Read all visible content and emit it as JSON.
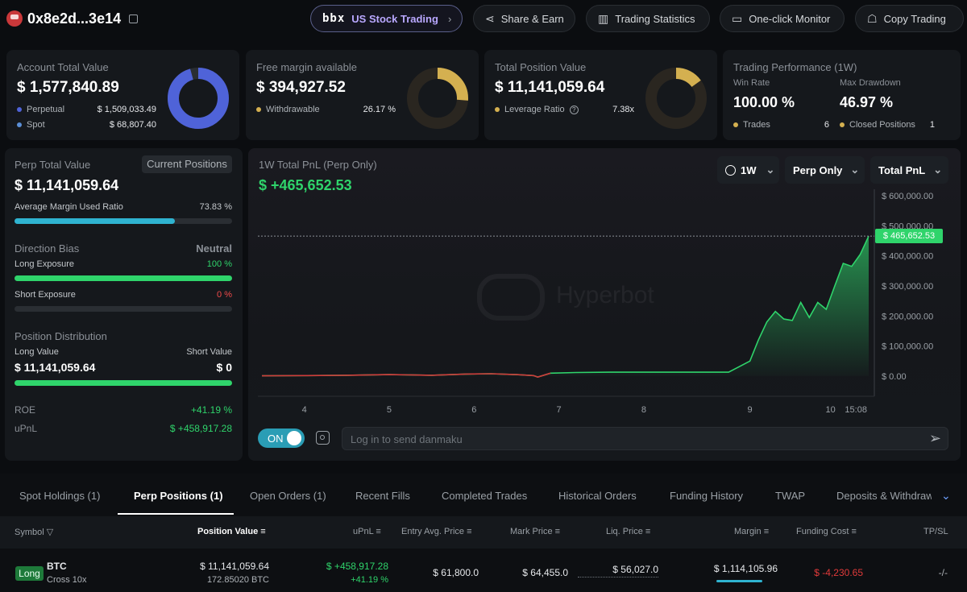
{
  "header": {
    "address": "0x8e2d...3e14",
    "buttons": {
      "us_stock_brand": "bbx",
      "us_stock": "US Stock Trading",
      "share": "Share & Earn",
      "stats": "Trading Statistics",
      "monitor": "One-click Monitor",
      "copy": "Copy Trading"
    }
  },
  "account": {
    "title": "Account Total Value",
    "value": "$ 1,577,840.89",
    "rows": [
      {
        "label": "Perpetual",
        "value": "$ 1,509,033.49",
        "color": "#4f63d8"
      },
      {
        "label": "Spot",
        "value": "$ 68,807.40",
        "color": "#5b8fd6"
      }
    ],
    "donut_fraction": 0.956,
    "donut_color": "#4f63d8"
  },
  "margin": {
    "title": "Free margin available",
    "value": "$ 394,927.52",
    "row_label": "Withdrawable",
    "row_value": "26.17 %",
    "donut_fraction": 0.2617,
    "donut_color": "#d4b050"
  },
  "position": {
    "title": "Total Position Value",
    "value": "$ 11,141,059.64",
    "row_label": "Leverage Ratio",
    "row_value": "7.38x",
    "donut_fraction": 0.15,
    "donut_color": "#d4b050"
  },
  "performance": {
    "title": "Trading Performance (1W)",
    "win_rate_label": "Win Rate",
    "win_rate": "100.00 %",
    "drawdown_label": "Max Drawdown",
    "drawdown": "46.97 %",
    "trades_label": "Trades",
    "trades": "6",
    "closed_label": "Closed Positions",
    "closed": "1"
  },
  "perp": {
    "title": "Perp Total Value",
    "current_positions": "Current Positions",
    "value": "$ 11,141,059.64",
    "margin_label": "Average Margin Used Ratio",
    "margin_pct": "73.83 %",
    "margin_fraction": 0.7383,
    "bias_label": "Direction Bias",
    "bias_value": "Neutral",
    "long_exp_label": "Long Exposure",
    "long_exp": "100 %",
    "long_fraction": 1.0,
    "short_exp_label": "Short Exposure",
    "short_exp": "0 %",
    "short_fraction": 0.0,
    "dist_label": "Position Distribution",
    "long_value_label": "Long Value",
    "long_value": "$ 11,141,059.64",
    "short_value_label": "Short Value",
    "short_value": "$ 0",
    "roe_label": "ROE",
    "roe": "+41.19 %",
    "upnl_label": "uPnL",
    "upnl": "$ +458,917.28"
  },
  "pnl_chart": {
    "title": "1W Total PnL (Perp Only)",
    "value": "$ +465,652.53",
    "dropdowns": {
      "period": "1W",
      "scope": "Perp Only",
      "metric": "Total PnL"
    },
    "watermark": "Hyperbot",
    "current_label": "$ 465,652.53",
    "toggle": "ON",
    "danmaku_placeholder": "Log in to send danmaku"
  },
  "chart_data": {
    "type": "area",
    "title": "1W Total PnL (Perp Only)",
    "x_ticks": [
      "4",
      "5",
      "6",
      "7",
      "8",
      "9",
      "10",
      "15:08"
    ],
    "y_ticks": [
      "$ 600,000.00",
      "$ 500,000.00",
      "$ 400,000.00",
      "$ 300,000.00",
      "$ 200,000.00",
      "$ 100,000.00",
      "$ 0.00"
    ],
    "ylim": [
      0,
      600000
    ],
    "xlim": [
      3.5,
      10.65
    ],
    "x": [
      3.5,
      4.0,
      4.5,
      5.0,
      5.5,
      5.9,
      6.2,
      6.5,
      6.7,
      6.75,
      6.9,
      7.2,
      7.6,
      8.0,
      8.5,
      9.0,
      9.25,
      9.35,
      9.45,
      9.55,
      9.65,
      9.75,
      9.85,
      9.95,
      10.05,
      10.15,
      10.25,
      10.35,
      10.45,
      10.55,
      10.65
    ],
    "values": [
      1000,
      2000,
      3000,
      5000,
      3000,
      7000,
      8000,
      5000,
      2000,
      -3000,
      10000,
      12000,
      13000,
      13000,
      13000,
      13000,
      50000,
      120000,
      180000,
      215000,
      190000,
      185000,
      245000,
      195000,
      245000,
      222000,
      300000,
      375000,
      365000,
      405000,
      465652
    ]
  },
  "tabs": [
    "Spot Holdings (1)",
    "Perp Positions (1)",
    "Open Orders (1)",
    "Recent Fills",
    "Completed Trades",
    "Historical Orders",
    "Funding History",
    "TWAP",
    "Deposits & Withdraw"
  ],
  "table": {
    "headers": {
      "symbol": "Symbol",
      "position_value": "Position Value",
      "upnl": "uPnL",
      "entry": "Entry Avg. Price",
      "mark": "Mark Price",
      "liq": "Liq. Price",
      "margin": "Margin",
      "funding": "Funding Cost",
      "tpsl": "TP/SL"
    },
    "row": {
      "side": "Long",
      "symbol": "BTC",
      "mode": "Cross 10x",
      "position_value": "$ 11,141,059.64",
      "position_size": "172.85020 BTC",
      "upnl": "$ +458,917.28",
      "upnl_pct": "+41.19 %",
      "entry": "$ 61,800.0",
      "mark": "$ 64,455.0",
      "liq": "$ 56,027.0",
      "margin": "$ 1,114,105.96",
      "funding": "$ -4,230.65",
      "tpsl": "-/-"
    }
  },
  "colors": {
    "accent_green": "#2fd46b",
    "accent_red": "#f04a4a",
    "margin_bar": "#2fb3d0",
    "gold": "#d4b050"
  }
}
